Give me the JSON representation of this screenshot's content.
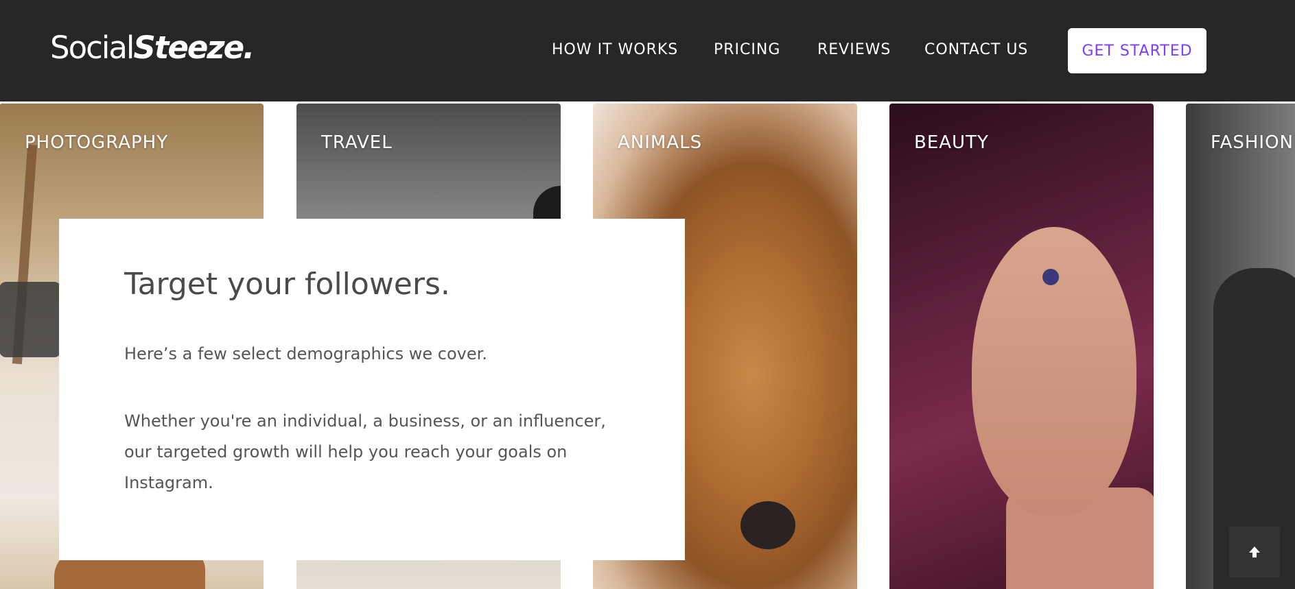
{
  "header": {
    "logo": {
      "part1": "Social",
      "part2": "Steeze."
    },
    "nav": [
      {
        "label": "HOW IT WORKS"
      },
      {
        "label": "PRICING"
      },
      {
        "label": "REVIEWS"
      },
      {
        "label": "CONTACT US"
      }
    ],
    "cta_label": "GET STARTED",
    "cta_color": "#7d3cff"
  },
  "categories": [
    {
      "label": "PHOTOGRAPHY"
    },
    {
      "label": "TRAVEL"
    },
    {
      "label": "ANIMALS"
    },
    {
      "label": "BEAUTY"
    },
    {
      "label": "FASHION"
    }
  ],
  "overlay": {
    "title": "Target your followers.",
    "paragraph1": "Here’s a few select demographics we cover.",
    "paragraph2": "Whether you're an individual, a business, or an influencer, our targeted growth will help you reach your goals on Instagram."
  },
  "icons": {
    "back_to_top": "arrow-up-icon"
  }
}
